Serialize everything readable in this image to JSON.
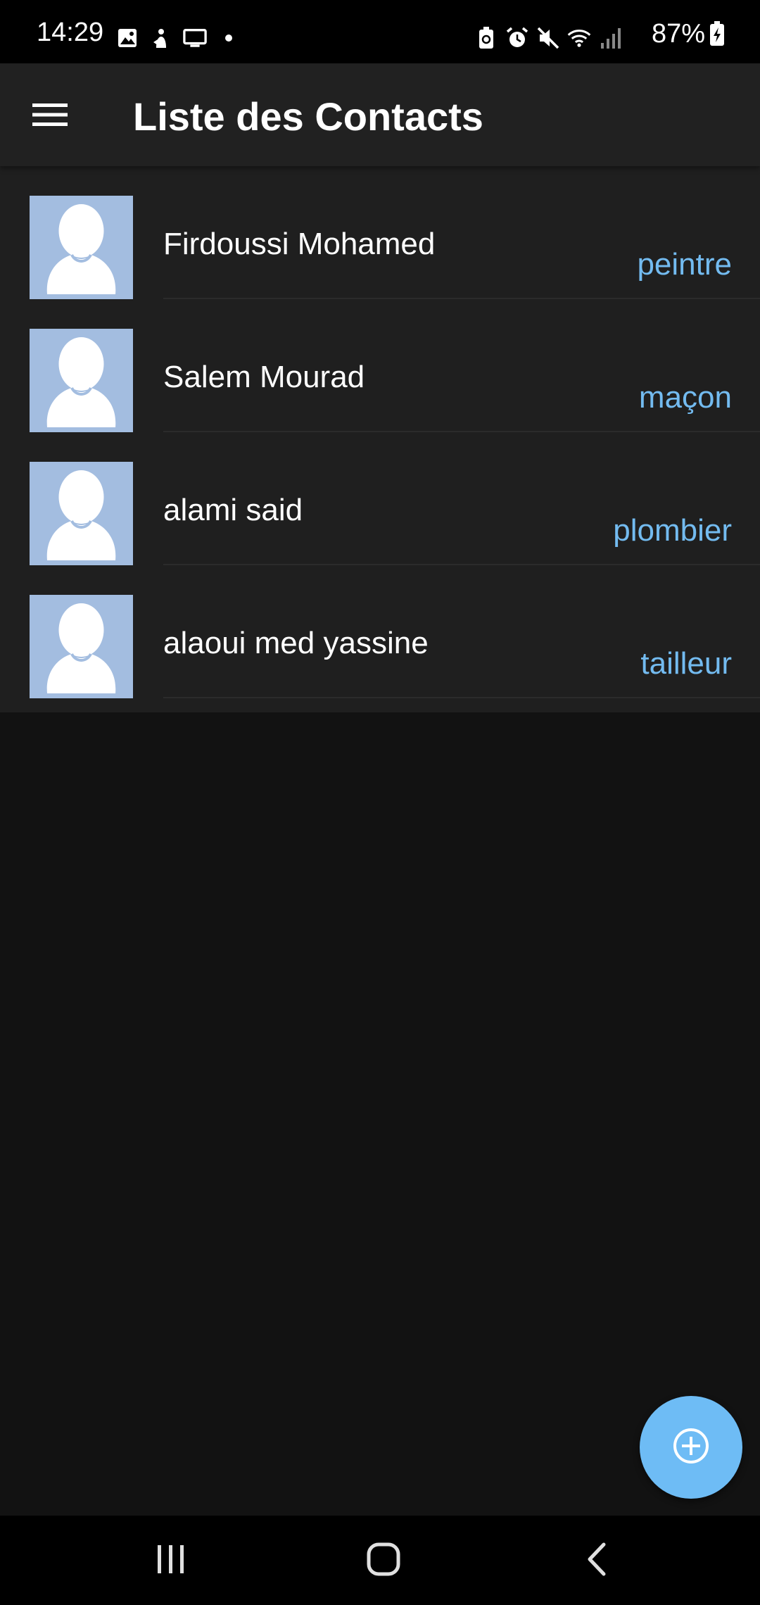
{
  "status_bar": {
    "time": "14:29",
    "left_icons": [
      "gallery-icon",
      "sync-icon",
      "cast-icon",
      "dot-icon"
    ],
    "right_icons": [
      "battery-saver-icon",
      "alarm-icon",
      "mute-icon",
      "wifi-icon",
      "signal-icon"
    ],
    "battery": "87%"
  },
  "app_bar": {
    "title": "Liste des Contacts",
    "menu_icon": "menu-icon"
  },
  "contacts": [
    {
      "name": "Firdoussi Mohamed",
      "job": "peintre"
    },
    {
      "name": "Salem Mourad",
      "job": "maçon"
    },
    {
      "name": "alami said",
      "job": "plombier"
    },
    {
      "name": "alaoui med yassine",
      "job": "tailleur"
    }
  ],
  "fab": {
    "icon": "add-circle-icon"
  },
  "nav_bar": {
    "icons": [
      "recent-apps-icon",
      "home-icon",
      "back-icon"
    ]
  },
  "colors": {
    "background": "#121212",
    "app_bar": "#212121",
    "list_background": "#1f1f1f",
    "accent": "#73bbf0",
    "fab": "#6ebcf5",
    "avatar_bg": "#a3bde0"
  }
}
